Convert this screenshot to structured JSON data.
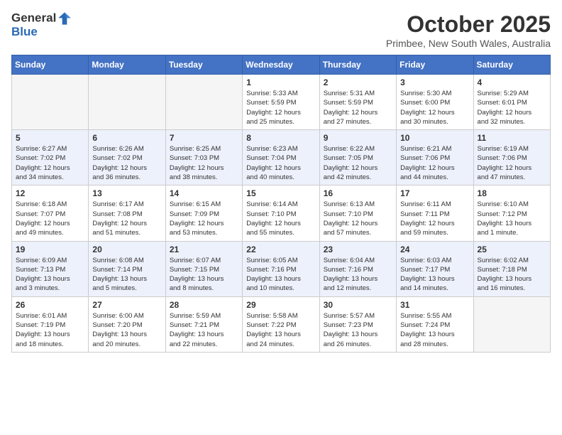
{
  "header": {
    "logo_general": "General",
    "logo_blue": "Blue",
    "title": "October 2025",
    "subtitle": "Primbee, New South Wales, Australia"
  },
  "days_of_week": [
    "Sunday",
    "Monday",
    "Tuesday",
    "Wednesday",
    "Thursday",
    "Friday",
    "Saturday"
  ],
  "weeks": [
    [
      {
        "day": "",
        "info": ""
      },
      {
        "day": "",
        "info": ""
      },
      {
        "day": "",
        "info": ""
      },
      {
        "day": "1",
        "info": "Sunrise: 5:33 AM\nSunset: 5:59 PM\nDaylight: 12 hours\nand 25 minutes."
      },
      {
        "day": "2",
        "info": "Sunrise: 5:31 AM\nSunset: 5:59 PM\nDaylight: 12 hours\nand 27 minutes."
      },
      {
        "day": "3",
        "info": "Sunrise: 5:30 AM\nSunset: 6:00 PM\nDaylight: 12 hours\nand 30 minutes."
      },
      {
        "day": "4",
        "info": "Sunrise: 5:29 AM\nSunset: 6:01 PM\nDaylight: 12 hours\nand 32 minutes."
      }
    ],
    [
      {
        "day": "5",
        "info": "Sunrise: 6:27 AM\nSunset: 7:02 PM\nDaylight: 12 hours\nand 34 minutes."
      },
      {
        "day": "6",
        "info": "Sunrise: 6:26 AM\nSunset: 7:02 PM\nDaylight: 12 hours\nand 36 minutes."
      },
      {
        "day": "7",
        "info": "Sunrise: 6:25 AM\nSunset: 7:03 PM\nDaylight: 12 hours\nand 38 minutes."
      },
      {
        "day": "8",
        "info": "Sunrise: 6:23 AM\nSunset: 7:04 PM\nDaylight: 12 hours\nand 40 minutes."
      },
      {
        "day": "9",
        "info": "Sunrise: 6:22 AM\nSunset: 7:05 PM\nDaylight: 12 hours\nand 42 minutes."
      },
      {
        "day": "10",
        "info": "Sunrise: 6:21 AM\nSunset: 7:06 PM\nDaylight: 12 hours\nand 44 minutes."
      },
      {
        "day": "11",
        "info": "Sunrise: 6:19 AM\nSunset: 7:06 PM\nDaylight: 12 hours\nand 47 minutes."
      }
    ],
    [
      {
        "day": "12",
        "info": "Sunrise: 6:18 AM\nSunset: 7:07 PM\nDaylight: 12 hours\nand 49 minutes."
      },
      {
        "day": "13",
        "info": "Sunrise: 6:17 AM\nSunset: 7:08 PM\nDaylight: 12 hours\nand 51 minutes."
      },
      {
        "day": "14",
        "info": "Sunrise: 6:15 AM\nSunset: 7:09 PM\nDaylight: 12 hours\nand 53 minutes."
      },
      {
        "day": "15",
        "info": "Sunrise: 6:14 AM\nSunset: 7:10 PM\nDaylight: 12 hours\nand 55 minutes."
      },
      {
        "day": "16",
        "info": "Sunrise: 6:13 AM\nSunset: 7:10 PM\nDaylight: 12 hours\nand 57 minutes."
      },
      {
        "day": "17",
        "info": "Sunrise: 6:11 AM\nSunset: 7:11 PM\nDaylight: 12 hours\nand 59 minutes."
      },
      {
        "day": "18",
        "info": "Sunrise: 6:10 AM\nSunset: 7:12 PM\nDaylight: 13 hours\nand 1 minute."
      }
    ],
    [
      {
        "day": "19",
        "info": "Sunrise: 6:09 AM\nSunset: 7:13 PM\nDaylight: 13 hours\nand 3 minutes."
      },
      {
        "day": "20",
        "info": "Sunrise: 6:08 AM\nSunset: 7:14 PM\nDaylight: 13 hours\nand 5 minutes."
      },
      {
        "day": "21",
        "info": "Sunrise: 6:07 AM\nSunset: 7:15 PM\nDaylight: 13 hours\nand 8 minutes."
      },
      {
        "day": "22",
        "info": "Sunrise: 6:05 AM\nSunset: 7:16 PM\nDaylight: 13 hours\nand 10 minutes."
      },
      {
        "day": "23",
        "info": "Sunrise: 6:04 AM\nSunset: 7:16 PM\nDaylight: 13 hours\nand 12 minutes."
      },
      {
        "day": "24",
        "info": "Sunrise: 6:03 AM\nSunset: 7:17 PM\nDaylight: 13 hours\nand 14 minutes."
      },
      {
        "day": "25",
        "info": "Sunrise: 6:02 AM\nSunset: 7:18 PM\nDaylight: 13 hours\nand 16 minutes."
      }
    ],
    [
      {
        "day": "26",
        "info": "Sunrise: 6:01 AM\nSunset: 7:19 PM\nDaylight: 13 hours\nand 18 minutes."
      },
      {
        "day": "27",
        "info": "Sunrise: 6:00 AM\nSunset: 7:20 PM\nDaylight: 13 hours\nand 20 minutes."
      },
      {
        "day": "28",
        "info": "Sunrise: 5:59 AM\nSunset: 7:21 PM\nDaylight: 13 hours\nand 22 minutes."
      },
      {
        "day": "29",
        "info": "Sunrise: 5:58 AM\nSunset: 7:22 PM\nDaylight: 13 hours\nand 24 minutes."
      },
      {
        "day": "30",
        "info": "Sunrise: 5:57 AM\nSunset: 7:23 PM\nDaylight: 13 hours\nand 26 minutes."
      },
      {
        "day": "31",
        "info": "Sunrise: 5:55 AM\nSunset: 7:24 PM\nDaylight: 13 hours\nand 28 minutes."
      },
      {
        "day": "",
        "info": ""
      }
    ]
  ]
}
